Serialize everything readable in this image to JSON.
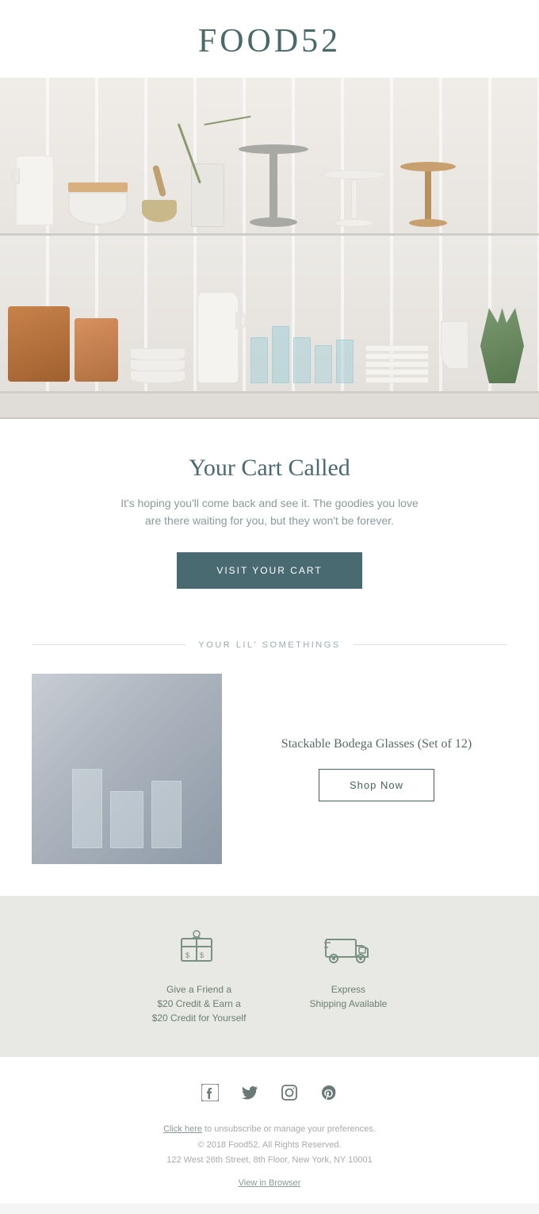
{
  "header": {
    "logo": "FOOD52"
  },
  "cart_section": {
    "title": "Your Cart Called",
    "description": "It's hoping you'll come back and see it. The goodies you love\nare there waiting for you, but they won't be forever.",
    "cta_label": "VISIT YOUR CART"
  },
  "section_divider": {
    "label": "YOUR LIL' SOMETHINGS"
  },
  "product": {
    "name": "Stackable Bodega Glasses (Set of 12)",
    "shop_now_label": "Shop Now"
  },
  "info_bar": {
    "items": [
      {
        "icon": "gift-card-icon",
        "text": "Give a Friend a\n$20 Credit & Earn a\n$20 Credit for Yourself"
      },
      {
        "icon": "truck-icon",
        "text": "Express\nShipping Available"
      }
    ]
  },
  "footer": {
    "social": [
      "facebook-icon",
      "twitter-icon",
      "instagram-icon",
      "pinterest-icon"
    ],
    "unsubscribe_text": " to unsubscribe or manage your preferences.",
    "click_here_label": "Click here",
    "copyright": "© 2018 Food52. All Rights Reserved.",
    "address": "122 West 26th Street, 8th Floor, New York, NY 10001",
    "view_in_browser": "View in Browser"
  }
}
